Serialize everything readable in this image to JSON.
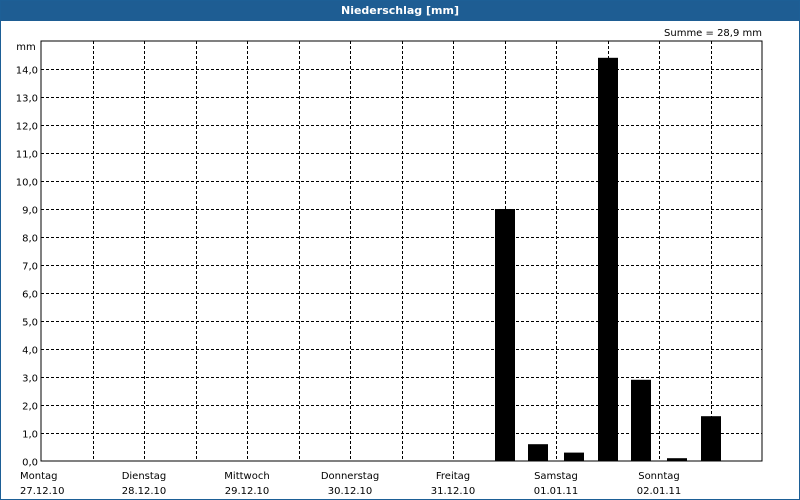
{
  "window_title": "Niederschlag [mm]",
  "chart_data": {
    "type": "bar",
    "title": "Niederschlag [mm]",
    "ylabel": "mm",
    "summary_text": "Summe = 28,9 mm",
    "ylim": [
      0,
      15
    ],
    "y_ticks": [
      {
        "value": 0,
        "label": "0,0"
      },
      {
        "value": 1,
        "label": "1,0"
      },
      {
        "value": 2,
        "label": "2,0"
      },
      {
        "value": 3,
        "label": "3,0"
      },
      {
        "value": 4,
        "label": "4,0"
      },
      {
        "value": 5,
        "label": "5,0"
      },
      {
        "value": 6,
        "label": "6,0"
      },
      {
        "value": 7,
        "label": "7,0"
      },
      {
        "value": 8,
        "label": "8,0"
      },
      {
        "value": 9,
        "label": "9,0"
      },
      {
        "value": 10,
        "label": "10,0"
      },
      {
        "value": 11,
        "label": "11,0"
      },
      {
        "value": 12,
        "label": "12,0"
      },
      {
        "value": 13,
        "label": "13,0"
      },
      {
        "value": 14,
        "label": "14,0"
      }
    ],
    "days": [
      {
        "weekday": "Montag",
        "date": "27.12.10"
      },
      {
        "weekday": "Dienstag",
        "date": "28.12.10"
      },
      {
        "weekday": "Mittwoch",
        "date": "29.12.10"
      },
      {
        "weekday": "Donnerstag",
        "date": "30.12.10"
      },
      {
        "weekday": "Freitag",
        "date": "31.12.10"
      },
      {
        "weekday": "Samstag",
        "date": "01.01.11"
      },
      {
        "weekday": "Sonntag",
        "date": "02.01.11"
      }
    ],
    "x_range_days": [
      0,
      7
    ],
    "bars": [
      {
        "day_offset": 4.5,
        "value": 9.0
      },
      {
        "day_offset": 4.83,
        "value": 0.6
      },
      {
        "day_offset": 5.17,
        "value": 0.3
      },
      {
        "day_offset": 5.5,
        "value": 14.4
      },
      {
        "day_offset": 5.83,
        "value": 2.9
      },
      {
        "day_offset": 6.17,
        "value": 0.1
      },
      {
        "day_offset": 6.5,
        "value": 1.6
      }
    ],
    "grid": true,
    "colors": {
      "bar": "#000000",
      "grid": "#000000",
      "titlebar": "#1e5d93",
      "frame": "#1d5f96"
    }
  }
}
